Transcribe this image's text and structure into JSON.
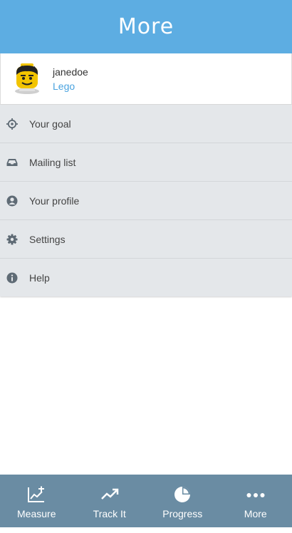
{
  "header": {
    "title": "More"
  },
  "profile": {
    "username": "janedoe",
    "theme": "Lego"
  },
  "menu": {
    "items": [
      {
        "label": "Your goal",
        "icon": "crosshair-icon"
      },
      {
        "label": "Mailing list",
        "icon": "inbox-icon"
      },
      {
        "label": "Your profile",
        "icon": "user-icon"
      },
      {
        "label": "Settings",
        "icon": "gear-icon"
      },
      {
        "label": "Help",
        "icon": "info-icon"
      }
    ]
  },
  "tabbar": {
    "tabs": [
      {
        "label": "Measure",
        "icon": "chart-plus-icon"
      },
      {
        "label": "Track It",
        "icon": "trending-up-icon"
      },
      {
        "label": "Progress",
        "icon": "pie-chart-icon"
      },
      {
        "label": "More",
        "icon": "ellipsis-icon"
      }
    ]
  },
  "colors": {
    "header": "#5dade2",
    "tabbar": "#6a8ca3",
    "menu_bg": "#e4e7ea",
    "link": "#4aa3df"
  }
}
